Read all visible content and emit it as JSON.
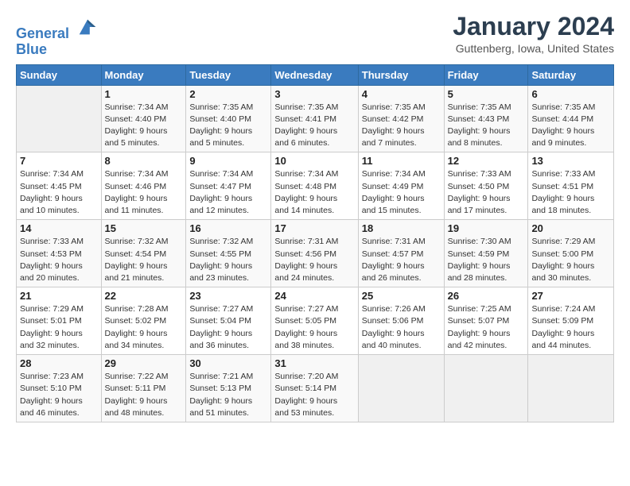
{
  "header": {
    "logo_line1": "General",
    "logo_line2": "Blue",
    "month_title": "January 2024",
    "location": "Guttenberg, Iowa, United States"
  },
  "weekdays": [
    "Sunday",
    "Monday",
    "Tuesday",
    "Wednesday",
    "Thursday",
    "Friday",
    "Saturday"
  ],
  "weeks": [
    [
      {
        "day": "",
        "info": ""
      },
      {
        "day": "1",
        "info": "Sunrise: 7:34 AM\nSunset: 4:40 PM\nDaylight: 9 hours\nand 5 minutes."
      },
      {
        "day": "2",
        "info": "Sunrise: 7:35 AM\nSunset: 4:40 PM\nDaylight: 9 hours\nand 5 minutes."
      },
      {
        "day": "3",
        "info": "Sunrise: 7:35 AM\nSunset: 4:41 PM\nDaylight: 9 hours\nand 6 minutes."
      },
      {
        "day": "4",
        "info": "Sunrise: 7:35 AM\nSunset: 4:42 PM\nDaylight: 9 hours\nand 7 minutes."
      },
      {
        "day": "5",
        "info": "Sunrise: 7:35 AM\nSunset: 4:43 PM\nDaylight: 9 hours\nand 8 minutes."
      },
      {
        "day": "6",
        "info": "Sunrise: 7:35 AM\nSunset: 4:44 PM\nDaylight: 9 hours\nand 9 minutes."
      }
    ],
    [
      {
        "day": "7",
        "info": "Sunrise: 7:34 AM\nSunset: 4:45 PM\nDaylight: 9 hours\nand 10 minutes."
      },
      {
        "day": "8",
        "info": "Sunrise: 7:34 AM\nSunset: 4:46 PM\nDaylight: 9 hours\nand 11 minutes."
      },
      {
        "day": "9",
        "info": "Sunrise: 7:34 AM\nSunset: 4:47 PM\nDaylight: 9 hours\nand 12 minutes."
      },
      {
        "day": "10",
        "info": "Sunrise: 7:34 AM\nSunset: 4:48 PM\nDaylight: 9 hours\nand 14 minutes."
      },
      {
        "day": "11",
        "info": "Sunrise: 7:34 AM\nSunset: 4:49 PM\nDaylight: 9 hours\nand 15 minutes."
      },
      {
        "day": "12",
        "info": "Sunrise: 7:33 AM\nSunset: 4:50 PM\nDaylight: 9 hours\nand 17 minutes."
      },
      {
        "day": "13",
        "info": "Sunrise: 7:33 AM\nSunset: 4:51 PM\nDaylight: 9 hours\nand 18 minutes."
      }
    ],
    [
      {
        "day": "14",
        "info": "Sunrise: 7:33 AM\nSunset: 4:53 PM\nDaylight: 9 hours\nand 20 minutes."
      },
      {
        "day": "15",
        "info": "Sunrise: 7:32 AM\nSunset: 4:54 PM\nDaylight: 9 hours\nand 21 minutes."
      },
      {
        "day": "16",
        "info": "Sunrise: 7:32 AM\nSunset: 4:55 PM\nDaylight: 9 hours\nand 23 minutes."
      },
      {
        "day": "17",
        "info": "Sunrise: 7:31 AM\nSunset: 4:56 PM\nDaylight: 9 hours\nand 24 minutes."
      },
      {
        "day": "18",
        "info": "Sunrise: 7:31 AM\nSunset: 4:57 PM\nDaylight: 9 hours\nand 26 minutes."
      },
      {
        "day": "19",
        "info": "Sunrise: 7:30 AM\nSunset: 4:59 PM\nDaylight: 9 hours\nand 28 minutes."
      },
      {
        "day": "20",
        "info": "Sunrise: 7:29 AM\nSunset: 5:00 PM\nDaylight: 9 hours\nand 30 minutes."
      }
    ],
    [
      {
        "day": "21",
        "info": "Sunrise: 7:29 AM\nSunset: 5:01 PM\nDaylight: 9 hours\nand 32 minutes."
      },
      {
        "day": "22",
        "info": "Sunrise: 7:28 AM\nSunset: 5:02 PM\nDaylight: 9 hours\nand 34 minutes."
      },
      {
        "day": "23",
        "info": "Sunrise: 7:27 AM\nSunset: 5:04 PM\nDaylight: 9 hours\nand 36 minutes."
      },
      {
        "day": "24",
        "info": "Sunrise: 7:27 AM\nSunset: 5:05 PM\nDaylight: 9 hours\nand 38 minutes."
      },
      {
        "day": "25",
        "info": "Sunrise: 7:26 AM\nSunset: 5:06 PM\nDaylight: 9 hours\nand 40 minutes."
      },
      {
        "day": "26",
        "info": "Sunrise: 7:25 AM\nSunset: 5:07 PM\nDaylight: 9 hours\nand 42 minutes."
      },
      {
        "day": "27",
        "info": "Sunrise: 7:24 AM\nSunset: 5:09 PM\nDaylight: 9 hours\nand 44 minutes."
      }
    ],
    [
      {
        "day": "28",
        "info": "Sunrise: 7:23 AM\nSunset: 5:10 PM\nDaylight: 9 hours\nand 46 minutes."
      },
      {
        "day": "29",
        "info": "Sunrise: 7:22 AM\nSunset: 5:11 PM\nDaylight: 9 hours\nand 48 minutes."
      },
      {
        "day": "30",
        "info": "Sunrise: 7:21 AM\nSunset: 5:13 PM\nDaylight: 9 hours\nand 51 minutes."
      },
      {
        "day": "31",
        "info": "Sunrise: 7:20 AM\nSunset: 5:14 PM\nDaylight: 9 hours\nand 53 minutes."
      },
      {
        "day": "",
        "info": ""
      },
      {
        "day": "",
        "info": ""
      },
      {
        "day": "",
        "info": ""
      }
    ]
  ]
}
